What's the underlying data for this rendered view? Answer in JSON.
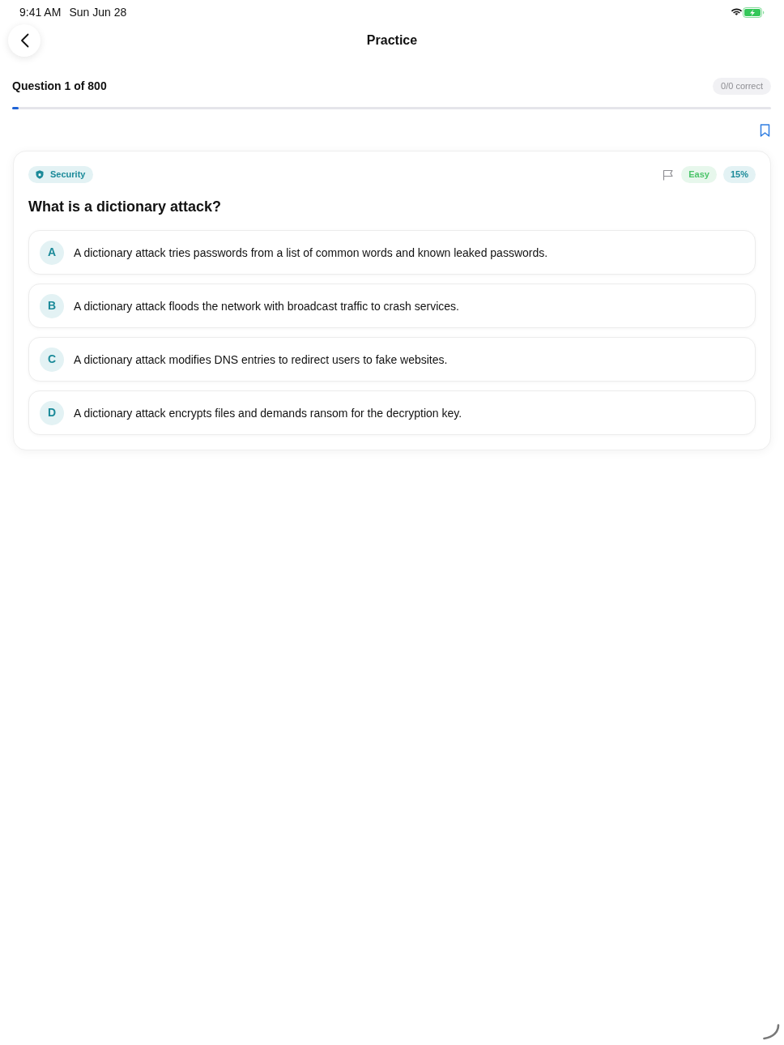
{
  "status_bar": {
    "time": "9:41 AM",
    "date": "Sun Jun 28"
  },
  "nav": {
    "title": "Practice"
  },
  "progress": {
    "label": "Question 1 of 800",
    "score": "0/0 correct",
    "level": 0.009
  },
  "bookmarked": false,
  "question": {
    "category": "Security",
    "flagged": false,
    "difficulty": "Easy",
    "percent": "15%",
    "text": "What is a dictionary attack?",
    "options": [
      {
        "letter": "A",
        "text": "A dictionary attack tries passwords from a list of common words and known leaked passwords.",
        "selected": false
      },
      {
        "letter": "B",
        "text": "A dictionary attack floods the network with broadcast traffic to crash services.",
        "selected": false
      },
      {
        "letter": "C",
        "text": "A dictionary attack modifies DNS entries to redirect users to fake websites.",
        "selected": false
      },
      {
        "letter": "D",
        "text": "A dictionary attack encrypts files and demands ransom for the decryption key.",
        "selected": false
      }
    ]
  }
}
